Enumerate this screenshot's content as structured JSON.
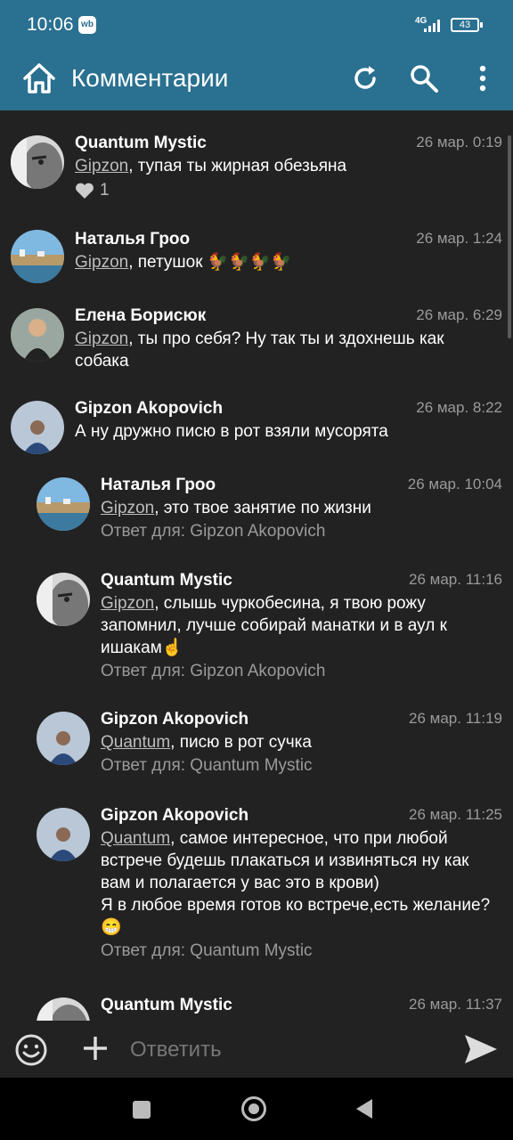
{
  "status": {
    "time": "10:06",
    "badge": "wb",
    "network": "4G",
    "battery": "43"
  },
  "appbar": {
    "title": "Комментарии"
  },
  "comments": [
    {
      "author": "Quantum Mystic",
      "time": "26 мар. 0:19",
      "mention": "Gipzon",
      "text": ", тупая ты жирная обезьяна",
      "likes": "1"
    },
    {
      "author": "Наталья Гроо",
      "time": "26 мар. 1:24",
      "mention": "Gipzon",
      "text": ", петушок 🐓🐓🐓🐓"
    },
    {
      "author": "Елена Борисюк",
      "time": "26 мар. 6:29",
      "mention": "Gipzon",
      "text": ", ты про себя? Ну так ты и здохнешь как собака"
    },
    {
      "author": "Gipzon Akopovich",
      "time": "26 мар. 8:22",
      "mention": "",
      "text": "А ну дружно писю в рот взяли мусорята"
    },
    {
      "author": "Наталья Гроо",
      "time": "26 мар. 10:04",
      "mention": "Gipzon",
      "text": ", это твое занятие по жизни",
      "reply": "Ответ для: Gipzon Akopovich"
    },
    {
      "author": "Quantum Mystic",
      "time": "26 мар. 11:16",
      "mention": "Gipzon",
      "text": ", слышь чуркобесина, я твою рожу запомнил, лучше собирай манатки и в аул к ишакам☝️",
      "reply": "Ответ для: Gipzon Akopovich"
    },
    {
      "author": "Gipzon Akopovich",
      "time": "26 мар. 11:19",
      "mention": "Quantum",
      "text": ", писю в рот сучка",
      "reply": "Ответ для: Quantum Mystic"
    },
    {
      "author": "Gipzon Akopovich",
      "time": "26 мар. 11:25",
      "mention": "Quantum",
      "text": ", самое интересное, что при любой встрече будешь плакаться и извиняться ну как вам и полагается у вас это в крови)\nЯ в любое время готов ко встрече,есть желание? 😁",
      "reply": "Ответ для: Quantum Mystic"
    },
    {
      "author": "Quantum Mystic",
      "time": "26 мар. 11:37"
    }
  ],
  "composer": {
    "placeholder": "Ответить"
  },
  "colors": {
    "appbar": "#2a7090",
    "background": "#222222"
  }
}
